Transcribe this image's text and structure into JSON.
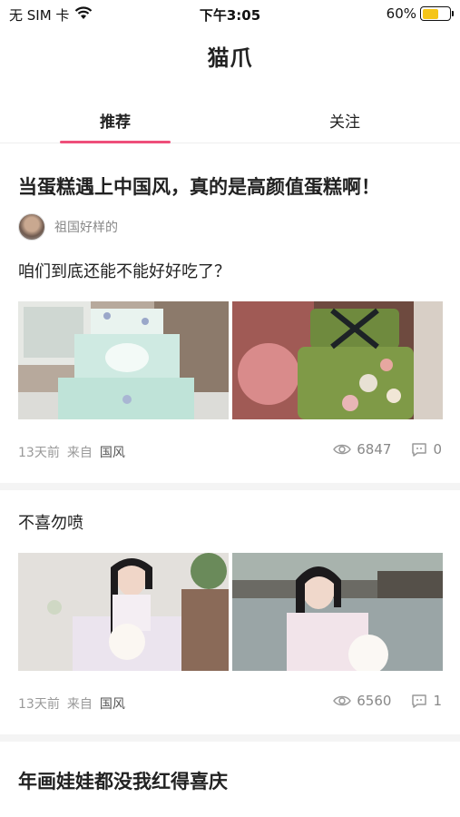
{
  "status_bar": {
    "carrier": "无 SIM 卡",
    "time": "下午3:05",
    "battery_text": "60%",
    "battery_level": 0.6,
    "battery_color": "#f5c518"
  },
  "app": {
    "title": "猫爪"
  },
  "tabs": [
    {
      "label": "推荐",
      "active": true
    },
    {
      "label": "关注",
      "active": false
    }
  ],
  "accent_color": "#ee4f7a",
  "posts": [
    {
      "title": "当蛋糕遇上中国风，真的是高颜值蛋糕啊！",
      "author": "祖国好样的",
      "text": "咱们到底还能不能好好吃了？",
      "images": [
        "mint-lotus-tiered-cake",
        "green-embroidered-cake"
      ],
      "time": "13天前",
      "from_label": "来自",
      "category": "国风",
      "views": "6847",
      "comments": "0"
    },
    {
      "text": "不喜勿喷",
      "images": [
        "hanfu-girl-with-fan",
        "hanfu-girl-by-water"
      ],
      "time": "13天前",
      "from_label": "来自",
      "category": "国风",
      "views": "6560",
      "comments": "1"
    },
    {
      "title": "年画娃娃都没我红得喜庆"
    }
  ],
  "icons": {
    "wifi": "wifi-icon",
    "views": "eye-icon",
    "comments": "comment-icon"
  }
}
